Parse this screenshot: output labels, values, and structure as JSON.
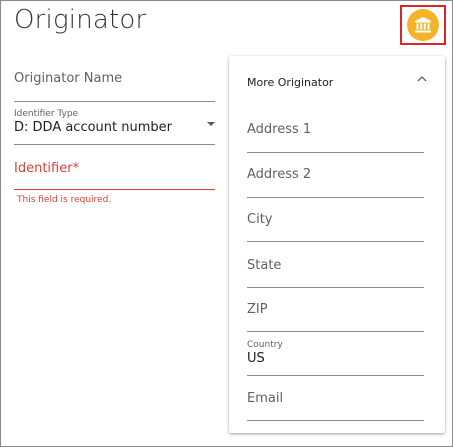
{
  "header": {
    "title": "Originator",
    "bank_icon": "bank-icon"
  },
  "form": {
    "originator_name": {
      "label": "Originator Name",
      "value": ""
    },
    "identifier_type": {
      "label": "Identifier Type",
      "value": "D: DDA account number"
    },
    "identifier": {
      "label": "Identifier*",
      "value": "",
      "error": "This field is required."
    }
  },
  "panel": {
    "title": "More Originator",
    "fields": {
      "address1": {
        "label": "Address 1",
        "value": ""
      },
      "address2": {
        "label": "Address 2",
        "value": ""
      },
      "city": {
        "label": "City",
        "value": ""
      },
      "state": {
        "label": "State",
        "value": ""
      },
      "zip": {
        "label": "ZIP",
        "value": ""
      },
      "country": {
        "label": "Country",
        "value": "US"
      },
      "email": {
        "label": "Email",
        "value": ""
      }
    }
  },
  "colors": {
    "accent": "#f5b428",
    "error": "#d84235",
    "highlight": "#d9262a"
  }
}
